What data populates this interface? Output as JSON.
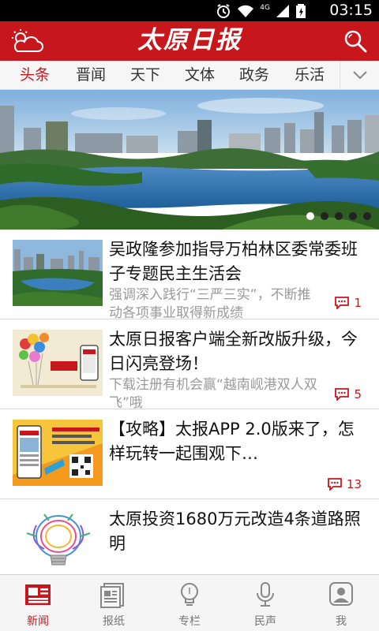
{
  "status_bar": {
    "time": "03:15",
    "network": "4G"
  },
  "header": {
    "logo_text": "太原日报",
    "accent": "#c8161d"
  },
  "tabs": [
    {
      "label": "头条",
      "active": true
    },
    {
      "label": "晋闻"
    },
    {
      "label": "天下"
    },
    {
      "label": "文体"
    },
    {
      "label": "政务"
    },
    {
      "label": "乐活"
    }
  ],
  "banner": {
    "slide_count": 5,
    "active_slide": 1
  },
  "news": [
    {
      "title": "吴政隆参加指导万柏林区委常委班子专题民主生活会",
      "summary": "强调深入践行“三严三实”，不断推动各项事业取得新成绩",
      "comments": "1"
    },
    {
      "title": "太原日报客户端全新改版升级，今日闪亮登场！",
      "summary": "下载注册有机会赢“越南岘港双人双飞”哦",
      "comments": "5"
    },
    {
      "title": "【攻略】太报APP 2.0版来了，怎样玩转一起围观下…",
      "summary": "",
      "comments": "13"
    },
    {
      "title": "太原投资1680万元改造4条道路照明",
      "summary": "",
      "comments": ""
    }
  ],
  "bottom_nav": [
    {
      "label": "新闻",
      "icon": "newspaper-icon",
      "active": true
    },
    {
      "label": "报纸",
      "icon": "paper-icon"
    },
    {
      "label": "专栏",
      "icon": "lightbulb-icon"
    },
    {
      "label": "民声",
      "icon": "microphone-icon"
    },
    {
      "label": "我",
      "icon": "user-icon"
    }
  ]
}
